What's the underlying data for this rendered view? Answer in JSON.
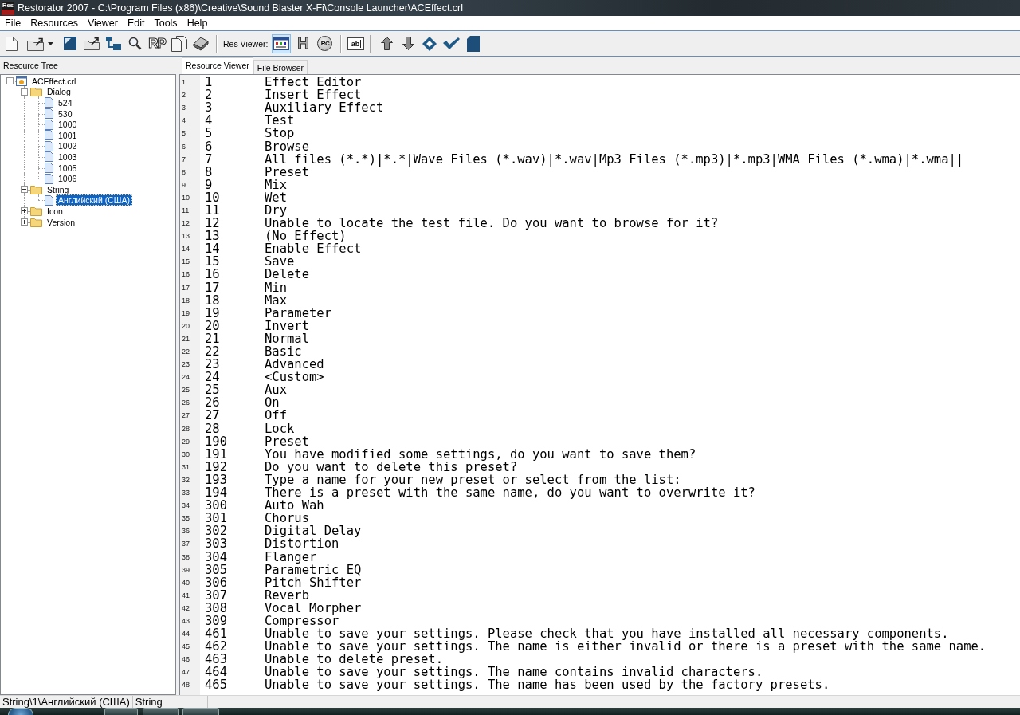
{
  "window": {
    "app_icon": "Res",
    "title": "Restorator 2007 - C:\\Program Files (x86)\\Creative\\Sound Blaster X-Fi\\Console Launcher\\ACEffect.crl"
  },
  "menu": [
    "File",
    "Resources",
    "Viewer",
    "Edit",
    "Tools",
    "Help"
  ],
  "toolbar": {
    "rp_button": "RP",
    "viewer_label": "Res Viewer:",
    "viewer_modes": [
      {
        "kind": "resource",
        "selected": true
      },
      {
        "kind": "hex",
        "label": "H",
        "selected": false
      },
      {
        "kind": "rc",
        "label": "RC",
        "selected": false
      }
    ],
    "text_button": "ab"
  },
  "resource_tree": {
    "title": "Resource Tree",
    "items": [
      {
        "kind": "file",
        "label": "ACEffect.crl",
        "expanded": true,
        "selected": false,
        "children": [
          {
            "kind": "folder",
            "label": "Dialog",
            "expanded": true,
            "selected": false,
            "children": [
              {
                "kind": "resource",
                "label": "524",
                "selected": false
              },
              {
                "kind": "resource",
                "label": "530",
                "selected": false
              },
              {
                "kind": "resource",
                "label": "1000",
                "selected": false
              },
              {
                "kind": "resource",
                "label": "1001",
                "selected": false
              },
              {
                "kind": "resource",
                "label": "1002",
                "selected": false
              },
              {
                "kind": "resource",
                "label": "1003",
                "selected": false
              },
              {
                "kind": "resource",
                "label": "1005",
                "selected": false
              },
              {
                "kind": "resource",
                "label": "1006",
                "selected": false
              }
            ]
          },
          {
            "kind": "folder",
            "label": "String",
            "expanded": true,
            "selected": false,
            "children": [
              {
                "kind": "resource",
                "label": "Английский (США)",
                "selected": true
              }
            ]
          },
          {
            "kind": "folder",
            "label": "Icon",
            "expanded": false,
            "selected": false
          },
          {
            "kind": "folder",
            "label": "Version",
            "expanded": false,
            "selected": false
          }
        ]
      }
    ]
  },
  "tabs": [
    {
      "label": "Resource Viewer",
      "selected": true
    },
    {
      "label": "File Browser",
      "selected": false
    }
  ],
  "editor": {
    "rows": [
      {
        "line": "1",
        "id": "1",
        "text": "Effect Editor"
      },
      {
        "line": "2",
        "id": "2",
        "text": "Insert Effect"
      },
      {
        "line": "3",
        "id": "3",
        "text": "Auxiliary Effect"
      },
      {
        "line": "4",
        "id": "4",
        "text": "Test"
      },
      {
        "line": "5",
        "id": "5",
        "text": "Stop"
      },
      {
        "line": "6",
        "id": "6",
        "text": "Browse"
      },
      {
        "line": "7",
        "id": "7",
        "text": "All files (*.*)|*.*|Wave Files (*.wav)|*.wav|Mp3 Files (*.mp3)|*.mp3|WMA Files (*.wma)|*.wma||"
      },
      {
        "line": "8",
        "id": "8",
        "text": "Preset"
      },
      {
        "line": "9",
        "id": "9",
        "text": "Mix"
      },
      {
        "line": "10",
        "id": "10",
        "text": "Wet"
      },
      {
        "line": "11",
        "id": "11",
        "text": "Dry"
      },
      {
        "line": "12",
        "id": "12",
        "text": "Unable to locate the test file. Do you want to browse for it?"
      },
      {
        "line": "13",
        "id": "13",
        "text": "(No Effect)"
      },
      {
        "line": "14",
        "id": "14",
        "text": "Enable Effect"
      },
      {
        "line": "15",
        "id": "15",
        "text": "Save"
      },
      {
        "line": "16",
        "id": "16",
        "text": "Delete"
      },
      {
        "line": "17",
        "id": "17",
        "text": "Min"
      },
      {
        "line": "18",
        "id": "18",
        "text": "Max"
      },
      {
        "line": "19",
        "id": "19",
        "text": "Parameter"
      },
      {
        "line": "20",
        "id": "20",
        "text": "Invert"
      },
      {
        "line": "21",
        "id": "21",
        "text": "Normal"
      },
      {
        "line": "22",
        "id": "22",
        "text": "Basic"
      },
      {
        "line": "23",
        "id": "23",
        "text": "Advanced"
      },
      {
        "line": "24",
        "id": "24",
        "text": "<Custom>"
      },
      {
        "line": "25",
        "id": "25",
        "text": "Aux"
      },
      {
        "line": "26",
        "id": "26",
        "text": "On"
      },
      {
        "line": "27",
        "id": "27",
        "text": "Off"
      },
      {
        "line": "28",
        "id": "28",
        "text": "Lock"
      },
      {
        "line": "29",
        "id": "190",
        "text": "Preset"
      },
      {
        "line": "30",
        "id": "191",
        "text": "You have modified some settings, do you want to save them?"
      },
      {
        "line": "31",
        "id": "192",
        "text": "Do you want to delete this preset?"
      },
      {
        "line": "32",
        "id": "193",
        "text": "Type a name for your new preset or select from the list:"
      },
      {
        "line": "33",
        "id": "194",
        "text": "There is a preset with the same name, do you want to overwrite it?"
      },
      {
        "line": "34",
        "id": "300",
        "text": "Auto Wah"
      },
      {
        "line": "35",
        "id": "301",
        "text": "Chorus"
      },
      {
        "line": "36",
        "id": "302",
        "text": "Digital Delay"
      },
      {
        "line": "37",
        "id": "303",
        "text": "Distortion"
      },
      {
        "line": "38",
        "id": "304",
        "text": "Flanger"
      },
      {
        "line": "39",
        "id": "305",
        "text": "Parametric EQ"
      },
      {
        "line": "40",
        "id": "306",
        "text": "Pitch Shifter"
      },
      {
        "line": "41",
        "id": "307",
        "text": "Reverb"
      },
      {
        "line": "42",
        "id": "308",
        "text": "Vocal Morpher"
      },
      {
        "line": "43",
        "id": "309",
        "text": "Compressor"
      },
      {
        "line": "44",
        "id": "461",
        "text": "Unable to save your settings. Please check that you have installed all necessary components."
      },
      {
        "line": "45",
        "id": "462",
        "text": "Unable to save your settings. The name is either invalid or there is a preset with the same name."
      },
      {
        "line": "46",
        "id": "463",
        "text": "Unable to delete preset."
      },
      {
        "line": "47",
        "id": "464",
        "text": "Unable to save your settings. The name contains invalid characters."
      },
      {
        "line": "48",
        "id": "465",
        "text": "Unable to save your settings. The name has been used by the factory presets."
      }
    ]
  },
  "status_bar": [
    "String\\1\\Английский (США)",
    "String"
  ]
}
